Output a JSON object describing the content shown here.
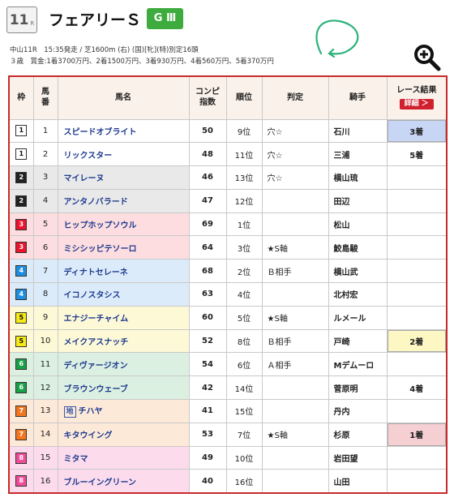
{
  "race": {
    "number": "11",
    "r_suffix": "R",
    "name": "フェアリーＳ",
    "grade": "G Ⅲ",
    "info_line1": "中山11R　15:35発走 / 芝1600m (右) (国)[牝](特)別定16頭",
    "info_line2": "３歳　賞金:1着3700万円、2着1500万円、3着930万円、4着560万円、5着370万円"
  },
  "icons": {
    "zoom": "zoom-in-icon",
    "annotation": "hand-drawn-arrow"
  },
  "colors": {
    "accent_red": "#c72a2a",
    "grade_green": "#3dab3d",
    "header_bg": "#faf1ea",
    "annotation_green": "#2bb37a"
  },
  "table": {
    "headers": {
      "waku": "枠",
      "umaban": "馬\n番",
      "horse": "馬名",
      "combi": "コンピ\n指数",
      "rank": "順位",
      "judgment": "判定",
      "jockey": "騎手",
      "result": "レース結果",
      "detail_button": "詳細 ＞"
    },
    "rows": [
      {
        "waku": "1",
        "umaban": "1",
        "horse": "スピードオブライト",
        "score": "50",
        "rank": "9位",
        "judgment": "穴☆",
        "jockey": "石川",
        "result": "3着"
      },
      {
        "waku": "1",
        "umaban": "2",
        "horse": "リックスター",
        "score": "48",
        "rank": "11位",
        "judgment": "穴☆",
        "jockey": "三浦",
        "result": "5着"
      },
      {
        "waku": "2",
        "umaban": "3",
        "horse": "マイレーヌ",
        "score": "46",
        "rank": "13位",
        "judgment": "穴☆",
        "jockey": "横山琉",
        "result": ""
      },
      {
        "waku": "2",
        "umaban": "4",
        "horse": "アンタノバラード",
        "score": "47",
        "rank": "12位",
        "judgment": "",
        "jockey": "田辺",
        "result": ""
      },
      {
        "waku": "3",
        "umaban": "5",
        "horse": "ヒップホップソウル",
        "score": "69",
        "rank": "1位",
        "judgment": "",
        "jockey": "松山",
        "result": ""
      },
      {
        "waku": "3",
        "umaban": "6",
        "horse": "ミシシッピテソーロ",
        "score": "64",
        "rank": "3位",
        "judgment": "★S軸",
        "jockey": "鮫島駿",
        "result": ""
      },
      {
        "waku": "4",
        "umaban": "7",
        "horse": "ディナトセレーネ",
        "score": "68",
        "rank": "2位",
        "judgment": "Ｂ相手",
        "jockey": "横山武",
        "result": ""
      },
      {
        "waku": "4",
        "umaban": "8",
        "horse": "イコノスタシス",
        "score": "63",
        "rank": "4位",
        "judgment": "",
        "jockey": "北村宏",
        "result": ""
      },
      {
        "waku": "5",
        "umaban": "9",
        "horse": "エナジーチャイム",
        "score": "60",
        "rank": "5位",
        "judgment": "★S軸",
        "jockey": "ルメール",
        "result": ""
      },
      {
        "waku": "5",
        "umaban": "10",
        "horse": "メイクアスナッチ",
        "score": "52",
        "rank": "8位",
        "judgment": "Ｂ相手",
        "jockey": "戸崎",
        "result": "2着"
      },
      {
        "waku": "6",
        "umaban": "11",
        "horse": "ディヴァージオン",
        "score": "54",
        "rank": "6位",
        "judgment": "Ａ相手",
        "jockey": "Mデムーロ",
        "result": ""
      },
      {
        "waku": "6",
        "umaban": "12",
        "horse": "ブラウンウェーブ",
        "score": "42",
        "rank": "14位",
        "judgment": "",
        "jockey": "菅原明",
        "result": "4着"
      },
      {
        "waku": "7",
        "umaban": "13",
        "horse": "チハヤ",
        "local_badge": "地",
        "score": "41",
        "rank": "15位",
        "judgment": "",
        "jockey": "丹内",
        "result": ""
      },
      {
        "waku": "7",
        "umaban": "14",
        "horse": "キタウイング",
        "score": "53",
        "rank": "7位",
        "judgment": "★S軸",
        "jockey": "杉原",
        "result": "1着"
      },
      {
        "waku": "8",
        "umaban": "15",
        "horse": "ミタマ",
        "score": "49",
        "rank": "10位",
        "judgment": "",
        "jockey": "岩田望",
        "result": ""
      },
      {
        "waku": "8",
        "umaban": "16",
        "horse": "ブルーイングリーン",
        "score": "40",
        "rank": "16位",
        "judgment": "",
        "jockey": "山田",
        "result": ""
      }
    ]
  }
}
